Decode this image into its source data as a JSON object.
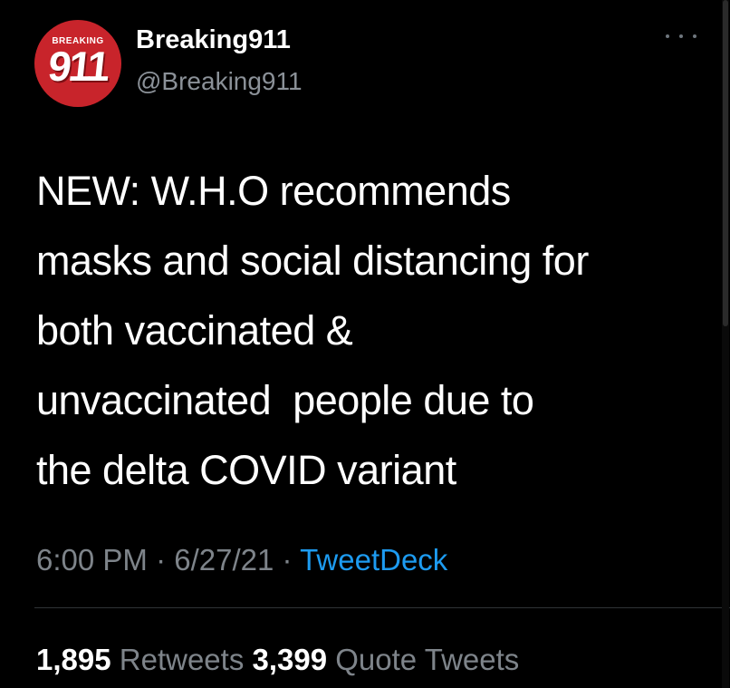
{
  "author": {
    "display_name": "Breaking911",
    "handle": "@Breaking911",
    "avatar": {
      "logo_top_text": "BREAKING",
      "logo_main_text": "911",
      "color": "#c8242b"
    }
  },
  "tweet": {
    "text": "NEW: W.H.O recommends\nmasks and social distancing for\nboth vaccinated &\nunvaccinated  people due to\nthe delta COVID variant",
    "time": "6:00 PM",
    "date": "6/27/21",
    "separator": " · ",
    "source": "TweetDeck"
  },
  "stats": {
    "retweets_count": "1,895",
    "retweets_label": "Retweets",
    "quote_tweets_count": "3,399",
    "quote_tweets_label": "Quote Tweets"
  },
  "icons": {
    "more": "more-horizontal-icon"
  },
  "colors": {
    "background": "#000000",
    "text": "#ffffff",
    "muted": "#7e848a",
    "link": "#1d9bf0"
  }
}
